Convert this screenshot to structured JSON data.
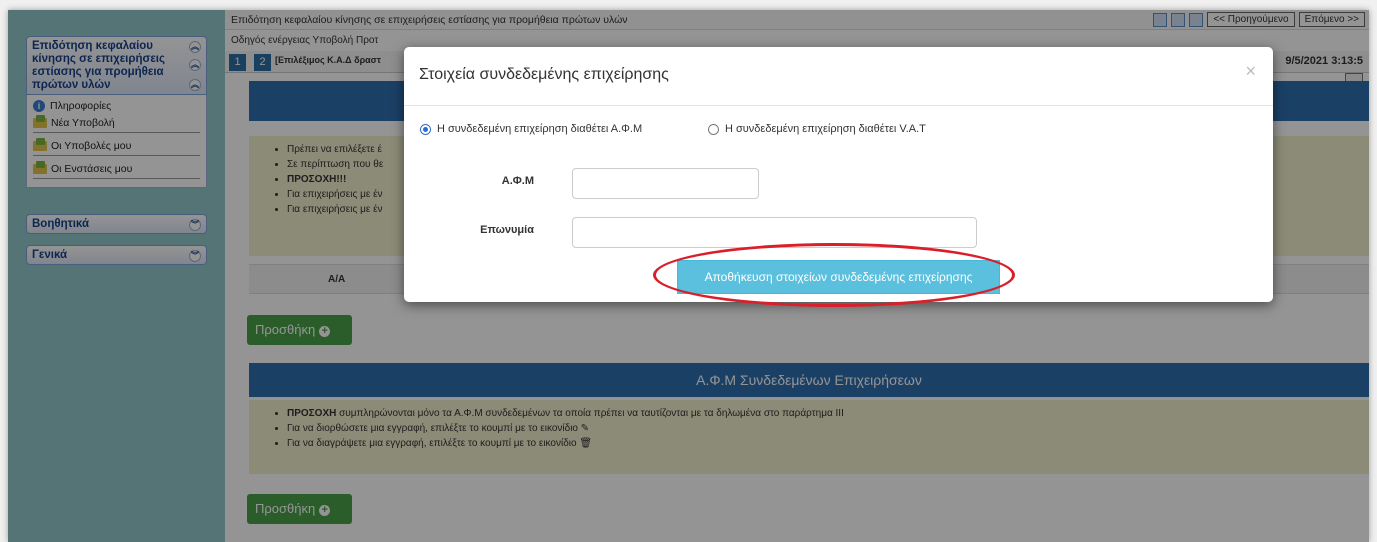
{
  "sidebar": {
    "panel1_title": "Επιδότηση κεφαλαίου κίνησης σε επιχειρήσεις εστίασης για προμήθεια πρώτων υλών",
    "items": [
      {
        "label": "Πληροφορίες",
        "icon": "info-icon"
      },
      {
        "label": "Νέα Υποβολή",
        "icon": "folder-icon"
      },
      {
        "label": "Οι Υποβολές μου",
        "icon": "folder-icon"
      },
      {
        "label": "Οι Ενστάσεις μου",
        "icon": "folder-icon"
      }
    ],
    "panel2_title": "Βοηθητικά",
    "panel3_title": "Γενικά"
  },
  "main": {
    "title": "Επιδότηση κεφαλαίου κίνησης σε επιχειρήσεις εστίασης για προμήθεια πρώτων υλών",
    "guide": "Οδηγός ενέργειας Υποβολή Προτ",
    "step1": "1",
    "step2": "2",
    "step_label": "[Επιλέξιμος Κ.Α.Δ δραστ",
    "prev_button": "<< Προηγούμενο",
    "next_button": "Επόμενο >>",
    "datetime": "9/5/2021 3:13:5",
    "bullets1": [
      "Πρέπει να επιλέξετε έ",
      "Σε περίπτωση που θε",
      "ΠΡΟΣΟΧΗ!!!",
      "Για επιχειρήσεις με έν",
      "Για επιχειρήσεις με έν"
    ],
    "table_header_aa": "Α/Α",
    "add_button": "Προσθήκη",
    "section2_title": "Α.Φ.Μ Συνδεδεμένων Επιχειρήσεων",
    "bullets2": [
      {
        "strong": "ΠΡΟΣΟΧΗ",
        "text": " συμπληρώνονται μόνο τα Α.Φ.Μ συνδεδεμένων τα οποία πρέπει να ταυτίζονται με τα δηλωμένα στο παράρτημα III"
      },
      {
        "strong": "",
        "text": "Για να διορθώσετε μια εγγραφή, επιλέξτε το κουμπί με το εικονίδιο"
      },
      {
        "strong": "",
        "text": "Για να διαγράψετε μια εγγραφή, επιλέξτε το κουμπί με το εικονίδιο"
      }
    ]
  },
  "modal": {
    "title": "Στοιχεία συνδεδεμένης επιχείρησης",
    "close": "×",
    "radio1": "Η συνδεδεμένη επιχείρηση διαθέτει Α.Φ.Μ",
    "radio2": "Η συνδεδεμένη επιχείρηση διαθέτει V.A.T",
    "selected": "radio1",
    "afm_label": "Α.Φ.Μ",
    "afm_value": "",
    "name_label": "Επωνυμία",
    "name_value": "",
    "save_button": "Αποθήκευση στοιχείων συνδεδεμένης επιχείρησης"
  },
  "colors": {
    "sidebar_bg": "#93c8cb",
    "band_blue": "#2f6fb0",
    "add_green": "#4aa04a",
    "save_cyan": "#5bc0de",
    "highlight_red": "#d9202a"
  }
}
